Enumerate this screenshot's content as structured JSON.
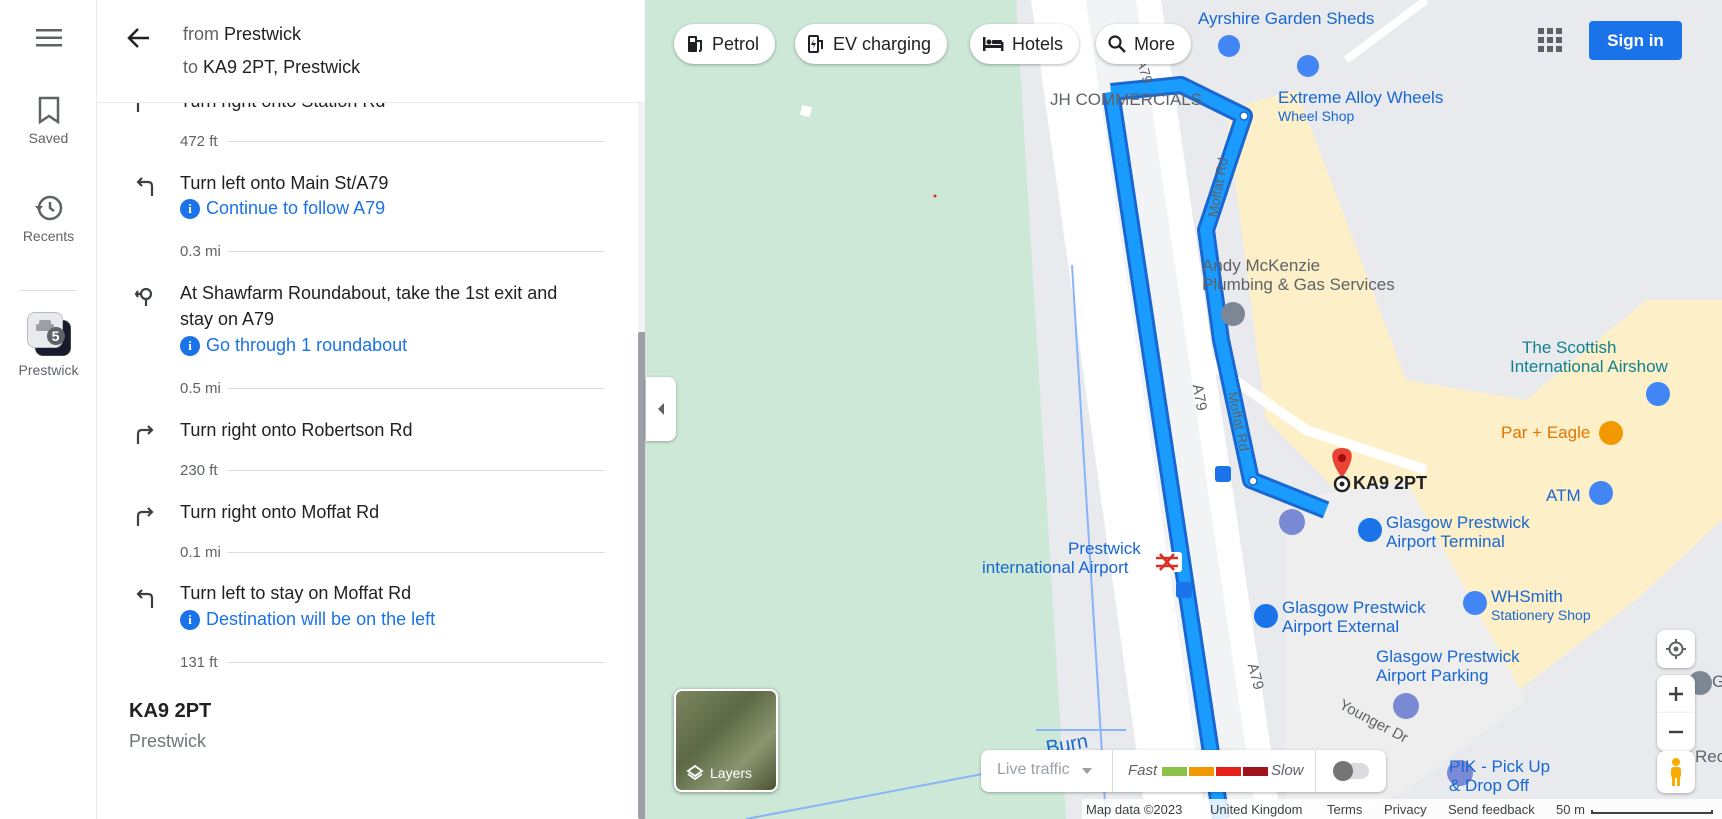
{
  "rail": {
    "saved_label": "Saved",
    "recents_label": "Recents",
    "recent_place_label": "Prestwick",
    "recent_place_count": "5"
  },
  "header": {
    "from_prefix": "from",
    "from_value": "Prestwick",
    "to_prefix": "to",
    "to_value": "KA9 2PT, Prestwick"
  },
  "steps": [
    {
      "text": "Turn right onto Station Rd",
      "icon": "turn-right-icon",
      "distance": "472 ft"
    },
    {
      "text": "Turn left onto Main St/A79",
      "icon": "turn-left-icon",
      "note": "Continue to follow A79",
      "distance": "0.3 mi"
    },
    {
      "text": "At Shawfarm Roundabout, take the 1st exit and stay on A79",
      "icon": "roundabout-icon",
      "note": "Go through 1 roundabout",
      "distance": "0.5 mi"
    },
    {
      "text": "Turn right onto Robertson Rd",
      "icon": "turn-right-icon",
      "distance": "230 ft"
    },
    {
      "text": "Turn right onto Moffat Rd",
      "icon": "turn-right-icon",
      "distance": "0.1 mi"
    },
    {
      "text": "Turn left to stay on Moffat Rd",
      "icon": "turn-left-icon",
      "note": "Destination will be on the left",
      "distance": "131 ft"
    }
  ],
  "destination": {
    "name": "KA9 2PT",
    "city": "Prestwick"
  },
  "chips": [
    {
      "label": "Petrol",
      "icon": "fuel-icon"
    },
    {
      "label": "EV charging",
      "icon": "ev-charging-icon"
    },
    {
      "label": "Hotels",
      "icon": "hotel-icon"
    },
    {
      "label": "More",
      "icon": "search-icon"
    }
  ],
  "sign_in_label": "Sign in",
  "map_labels": {
    "ayrshire": "Ayrshire Garden Sheds",
    "jh": "JH COMMERCIALS",
    "extreme": "Extreme Alloy Wheels",
    "extreme_sub": "Wheel Shop",
    "andy_1": "Andy McKenzie",
    "andy_2": "Plumbing & Gas Services",
    "scottish_1": "The Scottish",
    "scottish_2": "International Airshow",
    "par": "Par + Eagle",
    "atm": "ATM",
    "ka9": "KA9 2PT",
    "gpat_1": "Glasgow Prestwick",
    "gpat_2": "Airport Terminal",
    "pia_1": "Prestwick",
    "pia_2": "international Airport",
    "whsmith": "WHSmith",
    "whsmith_sub": "Stationery Shop",
    "gpae_1": "Glasgow Prestwick",
    "gpae_2": "Airport External",
    "gpap_1": "Glasgow Prestwick",
    "gpap_2": "Airport Parking",
    "younger": "Younger Dr",
    "pik_1": "PIK - Pick Up",
    "pik_2": "& Drop Off",
    "burn": "Burn",
    "moffat_1": "Moffat Rd",
    "moffat_2": "Moffat Rd",
    "a79_1": "A79",
    "a79_2": "A79",
    "a79_top": "A79",
    "rec": "Rec",
    "g": "G"
  },
  "layers_label": "Layers",
  "traffic": {
    "live_label": "Live traffic",
    "fast_label": "Fast",
    "slow_label": "Slow",
    "colors": [
      "#8bc34a",
      "#f29900",
      "#e52119",
      "#a1131c"
    ]
  },
  "footer": {
    "map_data": "Map data ©2023",
    "country": "United Kingdom",
    "terms": "Terms",
    "privacy": "Privacy",
    "feedback": "Send feedback",
    "scale": "50 m"
  },
  "colors": {
    "route": "#1a9cff",
    "route_border": "#1967d2",
    "park": "#cde8d6",
    "accent": "#1a73e8"
  }
}
